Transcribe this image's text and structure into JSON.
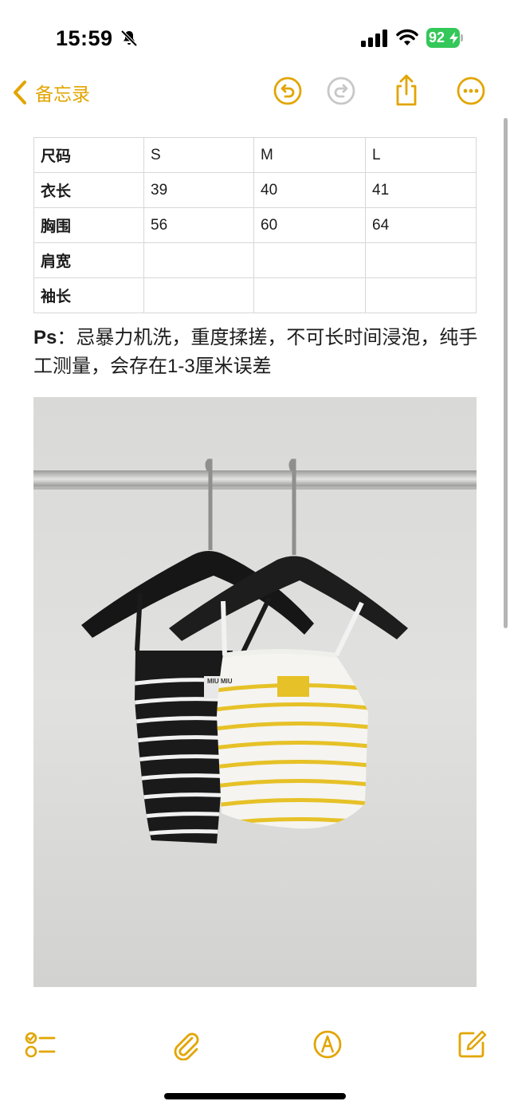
{
  "status": {
    "time": "15:59",
    "battery": "92",
    "icons": [
      "bell-slash-icon",
      "cellular-signal-icon",
      "wifi-icon",
      "battery-charging-icon"
    ]
  },
  "nav": {
    "back_label": "备忘录",
    "icons": [
      "chevron-left-icon",
      "undo-icon",
      "redo-icon",
      "share-icon",
      "more-icon"
    ]
  },
  "colors": {
    "accent": "#e2a500",
    "disabled": "#c7c7c7",
    "battery": "#34c759"
  },
  "table": {
    "header": [
      "尺码",
      "S",
      "M",
      "L"
    ],
    "rows": [
      [
        "衣长",
        "39",
        "40",
        "41"
      ],
      [
        "胸围",
        "56",
        "60",
        "64"
      ],
      [
        "肩宽",
        "",
        "",
        ""
      ],
      [
        "袖长",
        "",
        "",
        ""
      ]
    ]
  },
  "note": {
    "prefix": "Ps",
    "text": "：忌暴力机洗，重度揉搓，不可长时间浸泡，纯手工测量，会存在1-3厘米误差"
  },
  "photo": {
    "logo": "MIU MIU"
  },
  "toolbar": {
    "icons": [
      "checklist-icon",
      "paperclip-icon",
      "markup-pen-icon",
      "compose-icon"
    ]
  }
}
